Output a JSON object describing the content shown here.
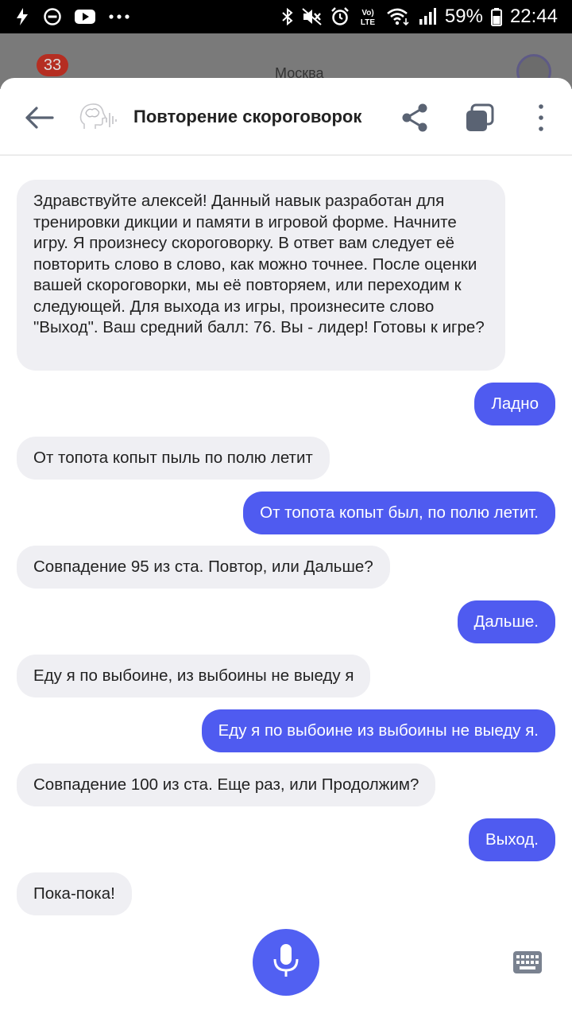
{
  "statusbar": {
    "left_icons": [
      "flash-icon",
      "do-not-disturb-icon",
      "youtube-icon",
      "more-notifications-icon"
    ],
    "right_icons": [
      "bluetooth-icon",
      "mute-icon",
      "alarm-icon",
      "volte-icon",
      "wifi-icon",
      "signal-icon"
    ],
    "volte_label": "VoLTE",
    "battery": "59%",
    "time": "22:44"
  },
  "background_app": {
    "badge": "33",
    "city": "Москва"
  },
  "header": {
    "title": "Повторение скороговорок",
    "icons": [
      "back-arrow-icon",
      "brain-skill-icon",
      "share-icon",
      "copy-icon",
      "more-vertical-icon"
    ]
  },
  "messages": [
    {
      "role": "bot",
      "text": "Здравствуйте алексей! Данный навык разработан для тренировки дикции и памяти в игровой форме. Начните игру. Я произнесу скороговорку. В ответ вам следует её повторить слово в слово, как можно точнее. После оценки вашей скороговорки, мы её повторяем, или переходим к следующей. Для выхода из игры, произнесите слово \"Выход\". Ваш средний балл: 76. Вы - лидер! Готовы к игре?"
    },
    {
      "role": "user",
      "text": "Ладно"
    },
    {
      "role": "bot",
      "text": "От топота копыт пыль по полю летит"
    },
    {
      "role": "user",
      "text": "От топота копыт был, по полю летит."
    },
    {
      "role": "bot",
      "text": "Совпадение 95 из ста. Повтор, или Дальше?"
    },
    {
      "role": "user",
      "text": "Дальше."
    },
    {
      "role": "bot",
      "text": "Еду я по выбоине, из выбоины не выеду я"
    },
    {
      "role": "user",
      "text": "Еду я по выбоине из выбоины не выеду я."
    },
    {
      "role": "bot",
      "text": "Совпадение 100 из ста. Еще раз, или Продолжим?"
    },
    {
      "role": "user",
      "text": "Выход."
    },
    {
      "role": "bot",
      "text": "Пока-пока!"
    }
  ],
  "bottom": {
    "icons": [
      "microphone-icon",
      "keyboard-icon"
    ]
  },
  "colors": {
    "user_bubble": "#4f5bf0",
    "bot_bubble": "#efeff3",
    "mic_button": "#5160f2",
    "header_icons": "#5a6373"
  }
}
